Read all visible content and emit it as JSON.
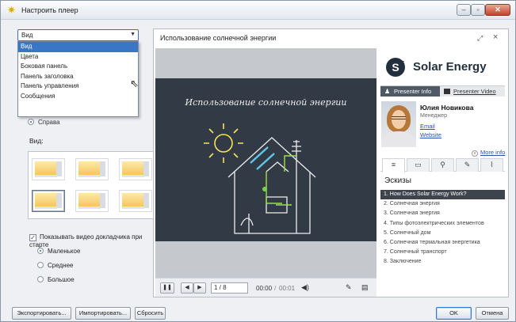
{
  "window": {
    "title": "Настроить плеер"
  },
  "left": {
    "dropdown_value": "Вид",
    "dropdown_options": [
      "Вид",
      "Цвета",
      "Боковая панель",
      "Панель заголовка",
      "Панель управления",
      "Сообщения"
    ],
    "partial_radio_label": "Справа",
    "view_label": "Вид:",
    "show_video_label": "Показывать видео докладчика при старте",
    "show_video_checked": true,
    "sizes": [
      "Маленькое",
      "Среднее",
      "Большое"
    ]
  },
  "preview": {
    "title": "Использование солнечной энергии",
    "slide_title": "Использование солнечной энергии",
    "slide_counter": "1 / 8",
    "time_current": "00:00",
    "time_total": "00:01"
  },
  "sidebar": {
    "logo_text": "Solar Energy",
    "tab_presenter_info": "Presenter Info",
    "tab_presenter_video": "Presenter Video",
    "presenter_name": "Юлия Новикова",
    "presenter_role": "Менеджер",
    "email_link": "Email",
    "website_link": "Website",
    "more_info": "More info",
    "section_title": "Эскизы",
    "slides": [
      "1.  How Does Solar Energy Work?",
      "2.  Солнечная энергия",
      "3.  Солнечная энергия",
      "4.  Типы фотоэлектрических элементов",
      "5.  Солнечный дом",
      "6.  Солнечная термальная энергетика",
      "7.  Солнечный транспорт",
      "8.  Заключение"
    ]
  },
  "footer": {
    "export": "Экспортировать...",
    "import": "Импортировать...",
    "reset": "Сбросить",
    "ok": "OK",
    "cancel": "Отмена"
  }
}
